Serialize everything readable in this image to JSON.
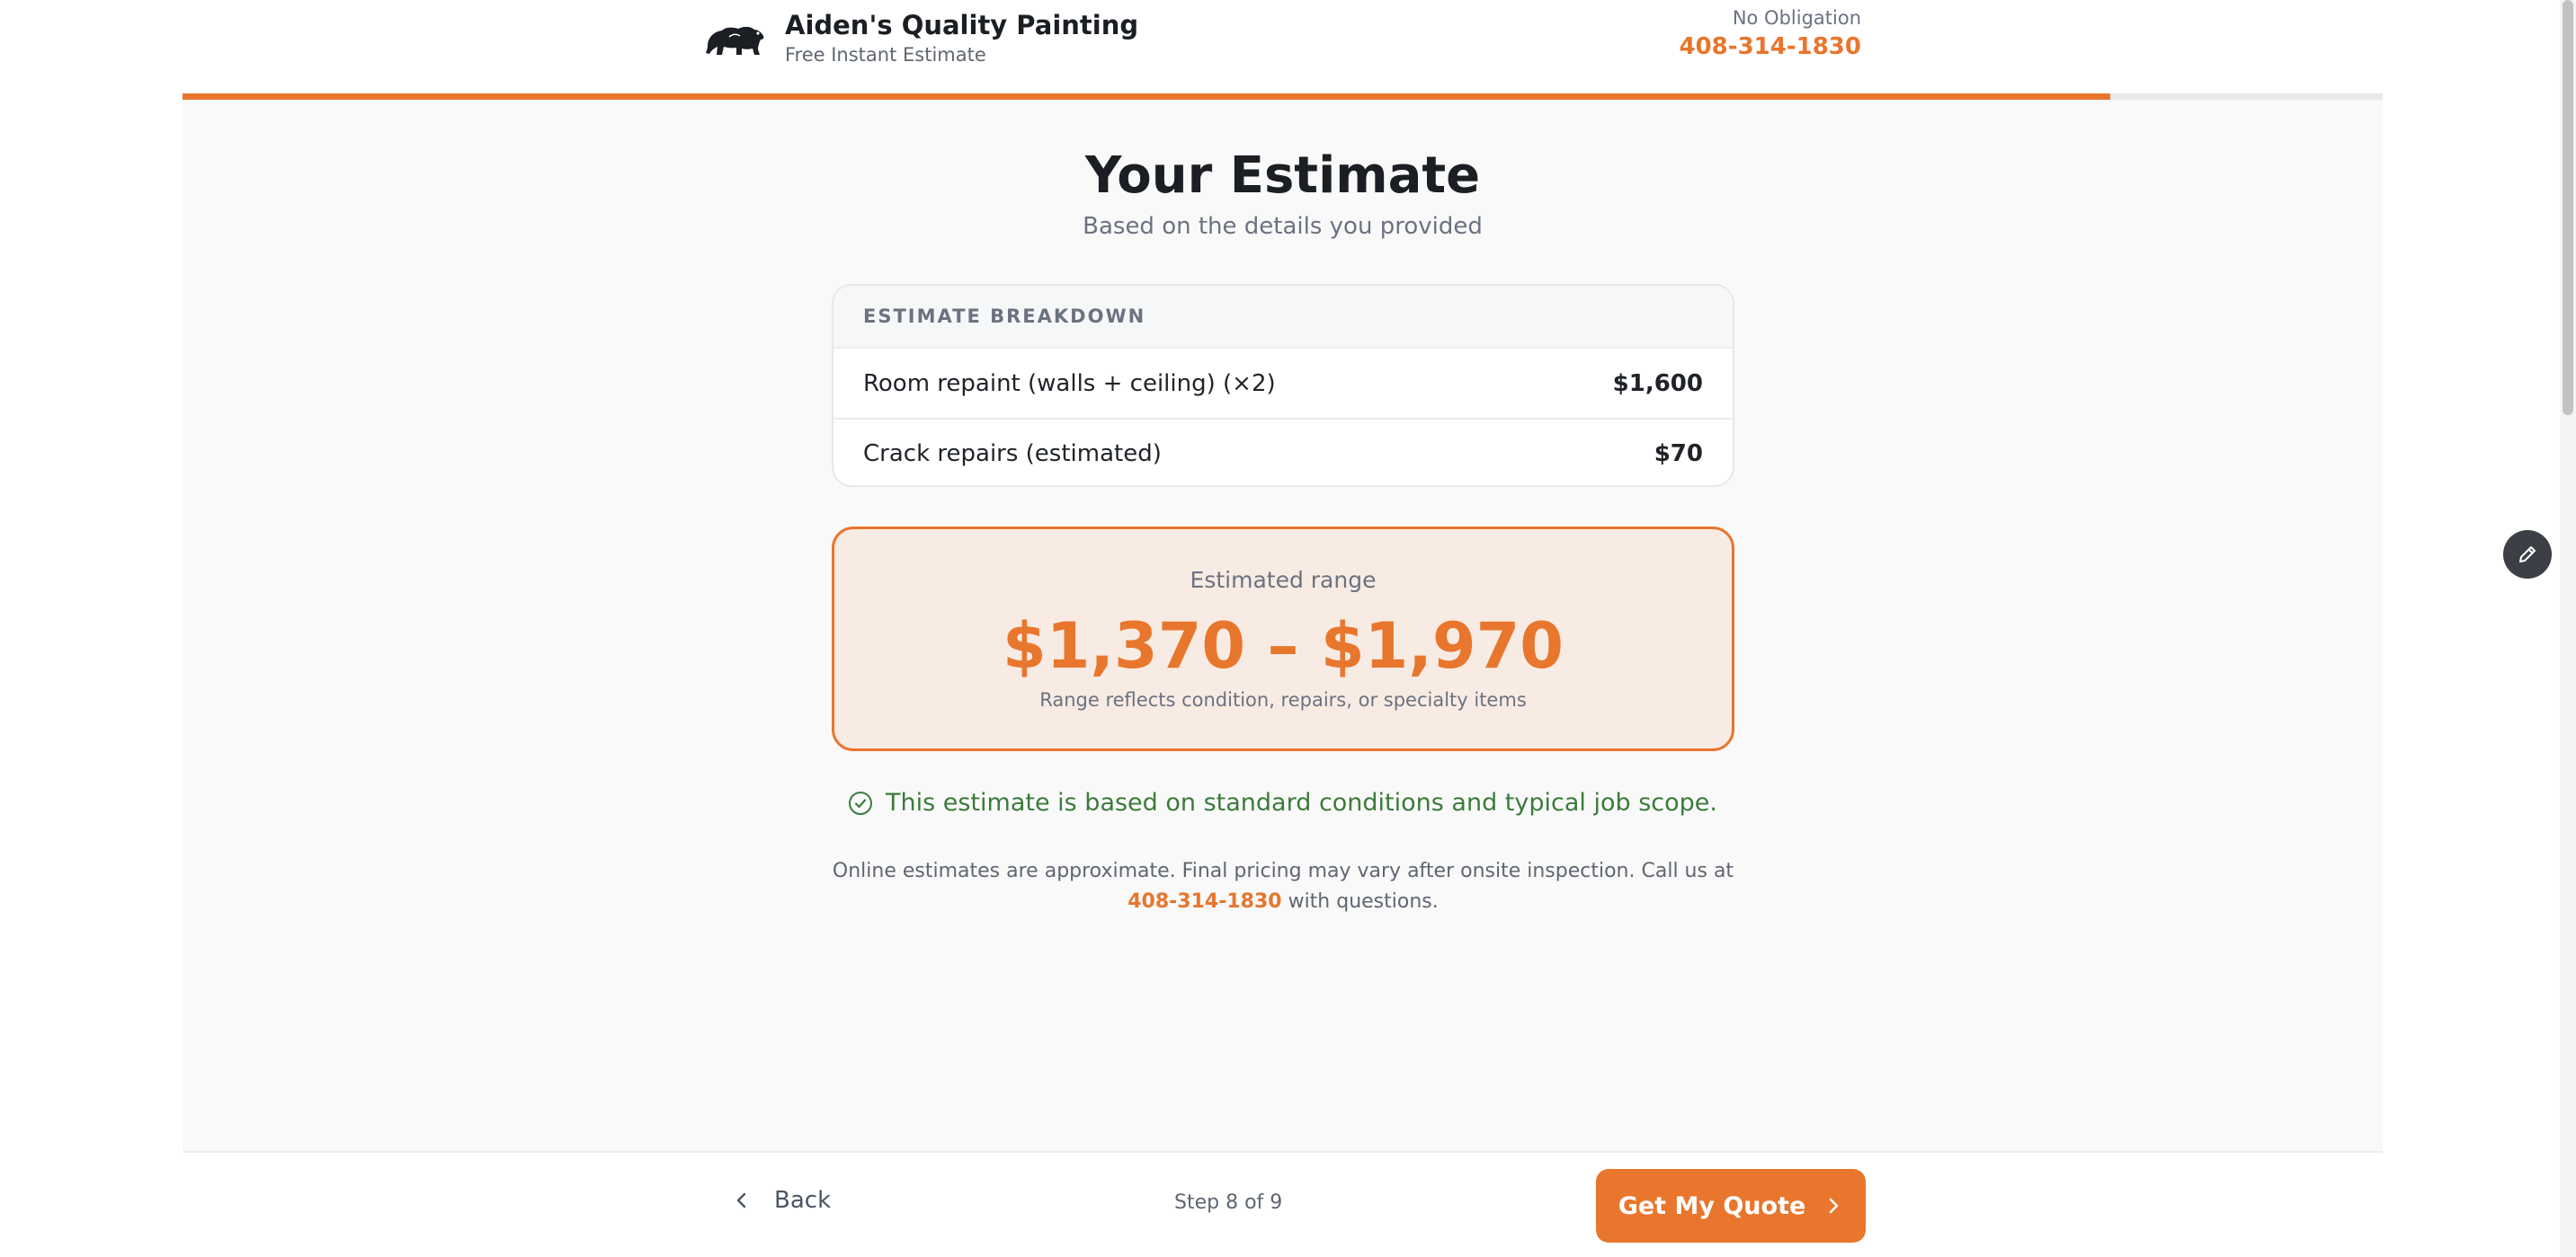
{
  "header": {
    "brand_name": "Aiden's Quality Painting",
    "brand_subtitle": "Free Instant Estimate",
    "no_obligation": "No Obligation",
    "phone": "408-314-1830",
    "logo_icon": "bear-logo-icon"
  },
  "progress": {
    "fraction": 0.876
  },
  "main": {
    "title": "Your Estimate",
    "subtitle": "Based on the details you provided",
    "breakdown": {
      "heading": "ESTIMATE BREAKDOWN",
      "rows": [
        {
          "label": "Room repaint (walls + ceiling) (×2)",
          "price": "$1,600"
        },
        {
          "label": "Crack repairs (estimated)",
          "price": "$70"
        }
      ]
    },
    "range": {
      "label": "Estimated range",
      "values": "$1,370 – $1,970",
      "note": "Range reflects condition, repairs, or specialty items"
    },
    "notice": {
      "icon": "check-circle-icon",
      "text": "This estimate is based on standard conditions and typical job scope."
    },
    "disclaimer": {
      "text_before": "Online estimates are approximate. Final pricing may vary after onsite inspection. Call us at ",
      "phone": "408-314-1830",
      "text_after": " with questions."
    }
  },
  "footer": {
    "back_label": "Back",
    "step_text": "Step 8 of 9",
    "quote_label": "Get My Quote"
  },
  "colors": {
    "accent": "#e8762d",
    "range_bg": "#f8ebe3",
    "notice_green": "#3c7a3c",
    "fab_bg": "#3c4046"
  },
  "floating": {
    "edit_icon": "pencil-icon"
  }
}
